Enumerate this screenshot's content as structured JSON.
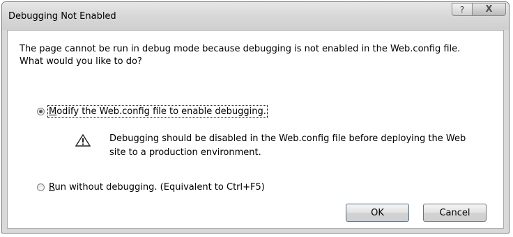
{
  "window": {
    "title": "Debugging Not Enabled",
    "help_glyph": "?",
    "close_glyph": "X"
  },
  "message": {
    "line1": "The page cannot be run in debug mode because debugging is not enabled in the Web.config file.",
    "line2": "What would you like to do?"
  },
  "options": [
    {
      "mnemonic": "M",
      "label_rest": "odify the Web.config file to enable debugging.",
      "selected": true
    },
    {
      "mnemonic": "R",
      "label_rest": "un without debugging. (Equivalent to Ctrl+F5)",
      "selected": false
    }
  ],
  "note": {
    "icon": "warning-icon",
    "line1": "Debugging should be disabled in the Web.config file before deploying the Web",
    "line2": "site to a production environment."
  },
  "buttons": {
    "ok": "OK",
    "cancel": "Cancel"
  }
}
